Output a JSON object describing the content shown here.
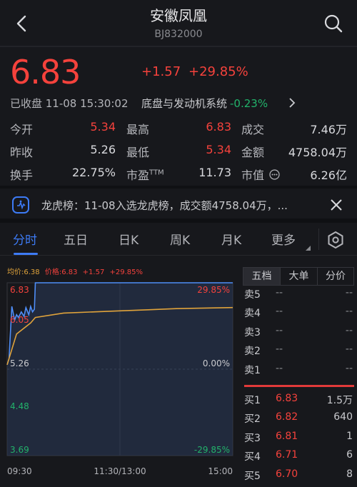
{
  "header": {
    "title": "安徽凤凰",
    "code": "BJ832000"
  },
  "quote": {
    "price": "6.83",
    "change": "+1.57",
    "change_pct": "+29.85%",
    "status": "已收盘 11-08 15:30:02",
    "sector_name": "底盘与发动机系统",
    "sector_change": "-0.23%"
  },
  "stats": {
    "row1": [
      {
        "label": "今开",
        "value": "5.34"
      },
      {
        "label": "最高",
        "value": "6.83"
      },
      {
        "label": "成交",
        "value": "7.46万"
      }
    ],
    "row2": [
      {
        "label": "昨收",
        "value": "5.26"
      },
      {
        "label": "最低",
        "value": "5.34"
      },
      {
        "label": "金额",
        "value": "4758.04万"
      }
    ],
    "row3": [
      {
        "label": "换手",
        "value": "22.75%"
      },
      {
        "label": "市盈",
        "label_sup": "TTM",
        "value": "11.73"
      },
      {
        "label": "市值",
        "value": "6.26亿"
      }
    ]
  },
  "notice": {
    "text": "龙虎榜：11-08入选龙虎榜，成交额4758.04万，..."
  },
  "tabs": [
    "分时",
    "五日",
    "日K",
    "周K",
    "月K",
    "更多"
  ],
  "chart_info": {
    "avg": "均价:6.38",
    "price": "价格:6.83",
    "chg": "+1.57",
    "pct": "+29.85%"
  },
  "chart_data": {
    "type": "line",
    "y_labels_left": [
      "6.83",
      "6.05",
      "5.26",
      "4.48",
      "3.69"
    ],
    "y_labels_right": [
      "29.85%",
      "0.00%",
      "-29.85%"
    ],
    "x_labels": [
      "09:30",
      "11:30/13:00",
      "15:00"
    ],
    "ylim": [
      3.69,
      6.83
    ],
    "series": [
      {
        "name": "价格",
        "color": "#4f8ef7",
        "x": [
          "09:30",
          "09:32",
          "09:35",
          "09:38",
          "09:40",
          "09:42",
          "09:45",
          "09:48",
          "09:50",
          "09:53",
          "09:55",
          "09:57",
          "09:59",
          "10:00",
          "10:05",
          "15:00"
        ],
        "y": [
          5.34,
          5.45,
          6.4,
          6.15,
          6.25,
          6.2,
          6.3,
          6.22,
          6.38,
          6.25,
          6.4,
          6.3,
          6.35,
          6.83,
          6.83,
          6.83
        ]
      },
      {
        "name": "均价",
        "color": "#e0a33b",
        "x": [
          "09:30",
          "09:40",
          "09:55",
          "10:00",
          "10:30",
          "11:30",
          "13:30",
          "14:00",
          "15:00"
        ],
        "y": [
          5.34,
          5.9,
          6.1,
          6.2,
          6.28,
          6.32,
          6.34,
          6.36,
          6.38
        ]
      }
    ]
  },
  "order_book": {
    "tabs": [
      "五档",
      "大单",
      "分价"
    ],
    "sell": [
      {
        "label": "卖5",
        "price": "--",
        "vol": "--"
      },
      {
        "label": "卖4",
        "price": "--",
        "vol": "--"
      },
      {
        "label": "卖3",
        "price": "--",
        "vol": "--"
      },
      {
        "label": "卖2",
        "price": "--",
        "vol": "--"
      },
      {
        "label": "卖1",
        "price": "--",
        "vol": "--"
      }
    ],
    "buy": [
      {
        "label": "买1",
        "price": "6.83",
        "vol": "1.5万"
      },
      {
        "label": "买2",
        "price": "6.82",
        "vol": "640"
      },
      {
        "label": "买3",
        "price": "6.81",
        "vol": "1"
      },
      {
        "label": "买4",
        "price": "6.71",
        "vol": "6"
      },
      {
        "label": "买5",
        "price": "6.70",
        "vol": "8"
      }
    ]
  }
}
